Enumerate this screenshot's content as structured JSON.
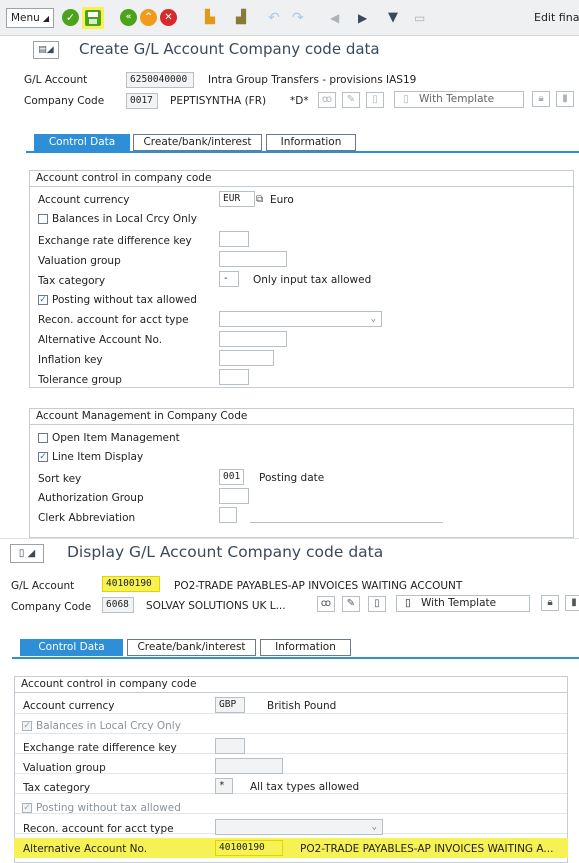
{
  "toolbar": {
    "menu_label": "Menu",
    "edit_label": "Edit fina",
    "colors": {
      "green": "#4aa31b",
      "orange": "#f19a1b",
      "red": "#d92a2a",
      "highlight": "#f7f253"
    }
  },
  "top": {
    "title": "Create G/L Account Company code data",
    "gl_label": "G/L Account",
    "gl_value": "6250040000",
    "gl_desc": "Intra Group Transfers - provisions IAS19",
    "cc_label": "Company Code",
    "cc_value": "0017",
    "cc_name": "PEPTISYNTHA (FR)",
    "cc_extra": "*D*",
    "template_label": "With Template",
    "tabs": [
      "Control Data",
      "Create/bank/interest",
      "Information"
    ],
    "group1": {
      "header": "Account control in company code",
      "currency_label": "Account currency",
      "currency_value": "EUR",
      "currency_name": "Euro",
      "balances_label": "Balances in Local Crcy Only",
      "exchange_label": "Exchange rate difference key",
      "valuation_label": "Valuation group",
      "tax_label": "Tax category",
      "tax_value": "-",
      "tax_desc": "Only input tax allowed",
      "posting_label": "Posting without tax allowed",
      "recon_label": "Recon. account for acct type",
      "alt_label": "Alternative Account No.",
      "inflation_label": "Inflation key",
      "tolerance_label": "Tolerance group"
    },
    "group2": {
      "header": "Account Management in Company Code",
      "open_item_label": "Open Item Management",
      "line_item_label": "Line Item Display",
      "sort_label": "Sort key",
      "sort_value": "001",
      "sort_desc": "Posting date",
      "auth_label": "Authorization Group",
      "clerk_label": "Clerk Abbreviation"
    }
  },
  "bottom": {
    "title": "Display G/L Account Company code data",
    "gl_label": "G/L Account",
    "gl_value": "40100190",
    "gl_desc": "PO2-TRADE PAYABLES-AP INVOICES WAITING ACCOUNT",
    "cc_label": "Company Code",
    "cc_value": "6068",
    "cc_name": "SOLVAY SOLUTIONS UK L...",
    "template_label": "With Template",
    "tabs": [
      "Control Data",
      "Create/bank/interest",
      "Information"
    ],
    "group": {
      "header": "Account control in company code",
      "currency_label": "Account currency",
      "currency_value": "GBP",
      "currency_name": "British Pound",
      "balances_label": "Balances in Local Crcy Only",
      "exchange_label": "Exchange rate difference key",
      "valuation_label": "Valuation group",
      "tax_label": "Tax category",
      "tax_value": "*",
      "tax_desc": "All tax types allowed",
      "posting_label": "Posting without tax allowed",
      "recon_label": "Recon. account for acct type",
      "alt_label": "Alternative Account No.",
      "alt_value": "40100190",
      "alt_desc": "PO2-TRADE PAYABLES-AP INVOICES WAITING A..."
    }
  }
}
